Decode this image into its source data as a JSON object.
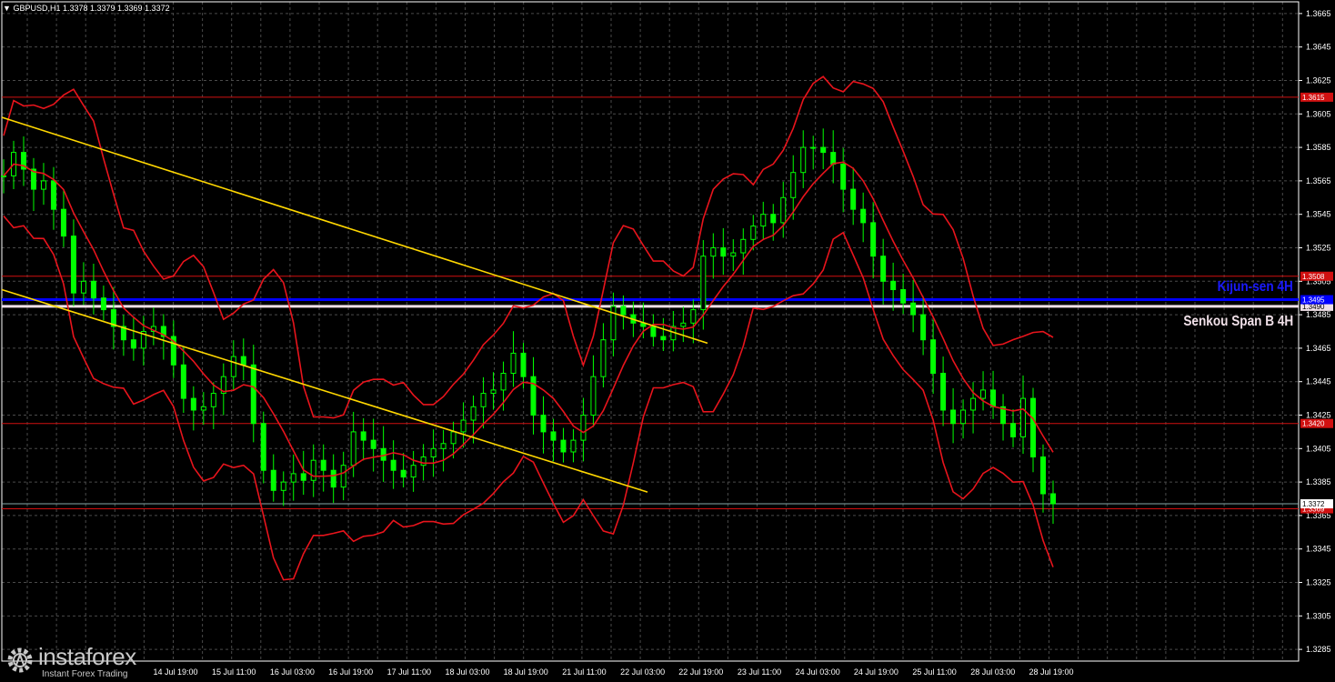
{
  "header": {
    "symbol_tf": "GBPUSD,H1",
    "ohlc": "1.3378 1.3379 1.3369 1.3372"
  },
  "watermark": {
    "brand": "instaforex",
    "tagline": "Instant Forex Trading"
  },
  "labels": {
    "kijun": "Kijun-sen 4H",
    "senkou": "Senkou Span B 4H"
  },
  "colors": {
    "background": "#000000",
    "grid": "#4a4a4a",
    "candles": "#00ff00",
    "bollinger": "#e8141c",
    "trendline": "#ffd700",
    "level_line": "#d01010",
    "kijun": "#0000ff",
    "senkou": "#f0e0e8",
    "axis_text": "#ffffff"
  },
  "chart_data": {
    "type": "line",
    "symbol": "GBPUSD",
    "timeframe": "H1",
    "ylim": [
      1.3278,
      1.3672
    ],
    "y_ticks": [
      "1.3665",
      "1.3645",
      "1.3625",
      "1.3605",
      "1.3585",
      "1.3565",
      "1.3545",
      "1.3525",
      "1.3505",
      "1.3485",
      "1.3465",
      "1.3445",
      "1.3425",
      "1.3405",
      "1.3385",
      "1.3365",
      "1.3345",
      "1.3325",
      "1.3305",
      "1.3285"
    ],
    "x_ticks": [
      "14 Jul 19:00",
      "15 Jul 11:00",
      "16 Jul 03:00",
      "16 Jul 19:00",
      "17 Jul 11:00",
      "18 Jul 03:00",
      "18 Jul 19:00",
      "21 Jul 11:00",
      "22 Jul 03:00",
      "22 Jul 19:00",
      "23 Jul 11:00",
      "24 Jul 03:00",
      "24 Jul 19:00",
      "25 Jul 11:00",
      "28 Jul 03:00",
      "28 Jul 19:00"
    ],
    "series": [
      {
        "values": [
          1.3568,
          1.3582,
          1.3572,
          1.356,
          1.3565,
          1.3548,
          1.3532,
          1.3498,
          1.3505,
          1.3495,
          1.3488,
          1.3478,
          1.347,
          1.3465,
          1.3475,
          1.3478,
          1.3472,
          1.3455,
          1.3435,
          1.3428,
          1.343,
          1.3438,
          1.3448,
          1.346,
          1.3455,
          1.342,
          1.3392,
          1.338,
          1.3385,
          1.339,
          1.3386,
          1.3398,
          1.3392,
          1.3382,
          1.3395,
          1.3415,
          1.341,
          1.3405,
          1.3398,
          1.3392,
          1.3388,
          1.3395,
          1.34,
          1.3405,
          1.3408,
          1.3415,
          1.3422,
          1.343,
          1.3438,
          1.344,
          1.345,
          1.3462,
          1.3448,
          1.3425,
          1.3415,
          1.341,
          1.3403,
          1.341,
          1.3425,
          1.3448,
          1.347,
          1.349,
          1.3485,
          1.348,
          1.3478,
          1.3472,
          1.347,
          1.3478,
          1.348,
          1.3488,
          1.352,
          1.3525,
          1.352,
          1.3522,
          1.353,
          1.3538,
          1.3545,
          1.354,
          1.3555,
          1.357,
          1.3585,
          1.3585,
          1.3582,
          1.3575,
          1.356,
          1.3548,
          1.354,
          1.352,
          1.3505,
          1.35,
          1.3492,
          1.3485,
          1.347,
          1.345,
          1.3428,
          1.342,
          1.3428,
          1.3435,
          1.344,
          1.343,
          1.342,
          1.3412,
          1.3435,
          1.34,
          1.3378,
          1.3372
        ]
      }
    ],
    "levels": [
      {
        "label": "1.3615",
        "value": 1.3615
      },
      {
        "label": "1.3508",
        "value": 1.3508
      },
      {
        "label": "1.3420",
        "value": 1.342
      },
      {
        "label": "1.3369",
        "value": 1.3369
      }
    ],
    "kijun_value": 1.3494,
    "kijun_label": "1.3495",
    "senkou_value": 1.349,
    "senkou_label": "1.3490",
    "current_price": 1.3372,
    "current_label": "1.3372",
    "grid": true
  }
}
